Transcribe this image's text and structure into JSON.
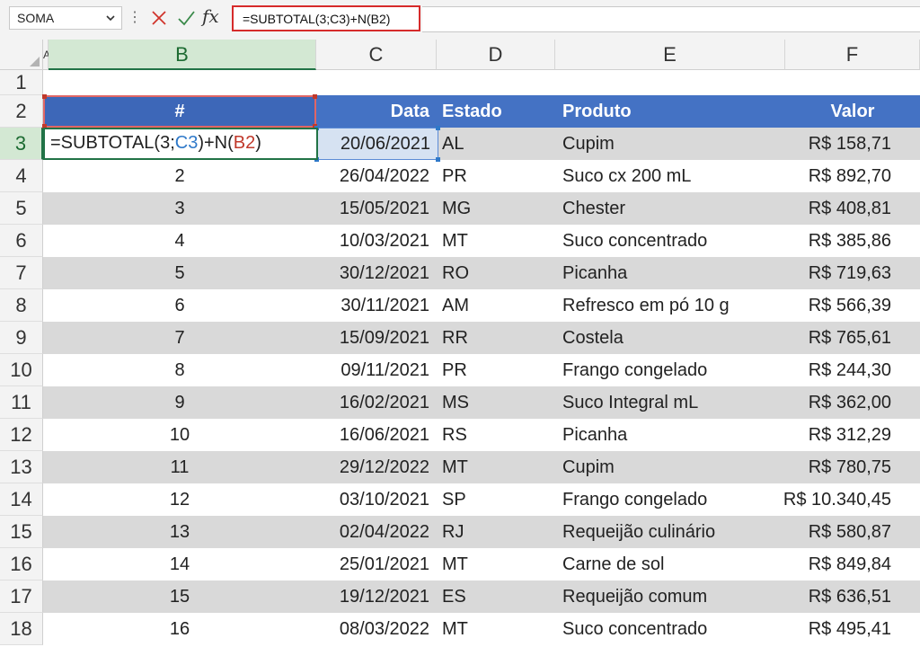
{
  "formula_bar": {
    "name_box": "SOMA",
    "formula": "=SUBTOTAL(3;C3)+N(B2)",
    "fx_label": "fx"
  },
  "columns": [
    "A",
    "B",
    "C",
    "D",
    "E",
    "F"
  ],
  "rows_numbers": [
    "1",
    "2",
    "3",
    "4",
    "5",
    "6",
    "7",
    "8",
    "9",
    "10",
    "11",
    "12",
    "13",
    "14",
    "15",
    "16",
    "17",
    "18"
  ],
  "table": {
    "headers": {
      "num": "#",
      "date": "Data",
      "state": "Estado",
      "product": "Produto",
      "value": "Valor"
    },
    "edit_cell": {
      "prefix": "=SUBTOTAL(3;",
      "ref1": "C3",
      "mid": ")+N(",
      "ref2": "B2",
      "suffix": ")"
    },
    "rows": [
      {
        "num": "",
        "date": "20/06/2021",
        "state": "AL",
        "product": "Cupim",
        "value": "R$ 158,71"
      },
      {
        "num": "2",
        "date": "26/04/2022",
        "state": "PR",
        "product": "Suco cx 200 mL",
        "value": "R$ 892,70"
      },
      {
        "num": "3",
        "date": "15/05/2021",
        "state": "MG",
        "product": "Chester",
        "value": "R$ 408,81"
      },
      {
        "num": "4",
        "date": "10/03/2021",
        "state": "MT",
        "product": "Suco concentrado",
        "value": "R$ 385,86"
      },
      {
        "num": "5",
        "date": "30/12/2021",
        "state": "RO",
        "product": "Picanha",
        "value": "R$ 719,63"
      },
      {
        "num": "6",
        "date": "30/11/2021",
        "state": "AM",
        "product": "Refresco em pó 10 g",
        "value": "R$ 566,39"
      },
      {
        "num": "7",
        "date": "15/09/2021",
        "state": "RR",
        "product": "Costela",
        "value": "R$ 765,61"
      },
      {
        "num": "8",
        "date": "09/11/2021",
        "state": "PR",
        "product": "Frango congelado",
        "value": "R$ 244,30"
      },
      {
        "num": "9",
        "date": "16/02/2021",
        "state": "MS",
        "product": "Suco Integral mL",
        "value": "R$ 362,00"
      },
      {
        "num": "10",
        "date": "16/06/2021",
        "state": "RS",
        "product": "Picanha",
        "value": "R$ 312,29"
      },
      {
        "num": "11",
        "date": "29/12/2022",
        "state": "MT",
        "product": "Cupim",
        "value": "R$ 780,75"
      },
      {
        "num": "12",
        "date": "03/10/2021",
        "state": "SP",
        "product": "Frango congelado",
        "value": "R$ 10.340,45"
      },
      {
        "num": "13",
        "date": "02/04/2022",
        "state": "RJ",
        "product": "Requeijão culinário",
        "value": "R$ 580,87"
      },
      {
        "num": "14",
        "date": "25/01/2021",
        "state": "MT",
        "product": "Carne de sol",
        "value": "R$ 849,84"
      },
      {
        "num": "15",
        "date": "19/12/2021",
        "state": "ES",
        "product": "Requeijão comum",
        "value": "R$ 636,51"
      },
      {
        "num": "16",
        "date": "08/03/2022",
        "state": "MT",
        "product": "Suco concentrado",
        "value": "R$ 495,41"
      }
    ]
  }
}
